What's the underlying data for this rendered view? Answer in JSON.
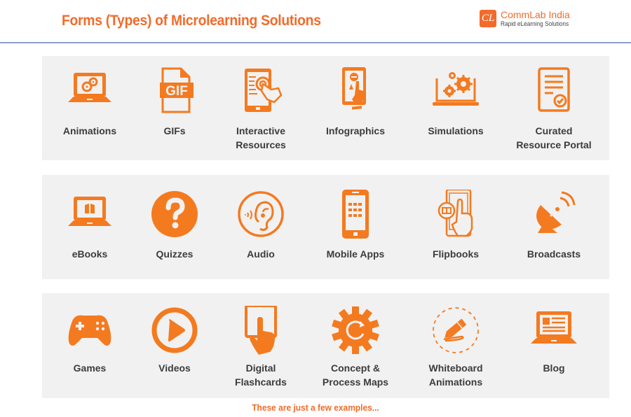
{
  "header": {
    "title": "Forms (Types) of Microlearning Solutions",
    "logo_mark": "CL",
    "logo_name": "CommLab India",
    "logo_tagline": "Rapid eLearning Solutions"
  },
  "accent_color": "#f26b2a",
  "rows": [
    {
      "items": [
        {
          "label_1": "Animations",
          "label_2": "",
          "icon": "laptop-gears-icon"
        },
        {
          "label_1": "GIFs",
          "label_2": "",
          "icon": "gif-file-icon"
        },
        {
          "label_1": "Interactive",
          "label_2": "Resources",
          "icon": "tablet-touch-icon"
        },
        {
          "label_1": "Infographics",
          "label_2": "",
          "icon": "tablet-person-tap-icon"
        },
        {
          "label_1": "Simulations",
          "label_2": "",
          "icon": "laptop-cogs-icon"
        },
        {
          "label_1": "Curated",
          "label_2": "Resource Portal",
          "icon": "document-check-icon"
        }
      ]
    },
    {
      "items": [
        {
          "label_1": "eBooks",
          "label_2": "",
          "icon": "laptop-book-icon"
        },
        {
          "label_1": "Quizzes",
          "label_2": "",
          "icon": "question-circle-icon"
        },
        {
          "label_1": "Audio",
          "label_2": "",
          "icon": "ear-icon"
        },
        {
          "label_1": "Mobile Apps",
          "label_2": "",
          "icon": "smartphone-grid-icon"
        },
        {
          "label_1": "Flipbooks",
          "label_2": "",
          "icon": "phone-flipbook-icon"
        },
        {
          "label_1": "Broadcasts",
          "label_2": "",
          "icon": "satellite-dish-icon"
        }
      ]
    },
    {
      "items": [
        {
          "label_1": "Games",
          "label_2": "",
          "icon": "gamepad-icon"
        },
        {
          "label_1": "Videos",
          "label_2": "",
          "icon": "play-circle-icon"
        },
        {
          "label_1": "Digital",
          "label_2": "Flashcards",
          "icon": "tap-card-icon"
        },
        {
          "label_1": "Concept &",
          "label_2": "Process Maps",
          "icon": "gear-refresh-icon"
        },
        {
          "label_1": "Whiteboard",
          "label_2": "Animations",
          "icon": "pencil-dashed-circle-icon"
        },
        {
          "label_1": "Blog",
          "label_2": "",
          "icon": "laptop-article-icon"
        }
      ]
    }
  ],
  "footer": "These are just a few examples..."
}
